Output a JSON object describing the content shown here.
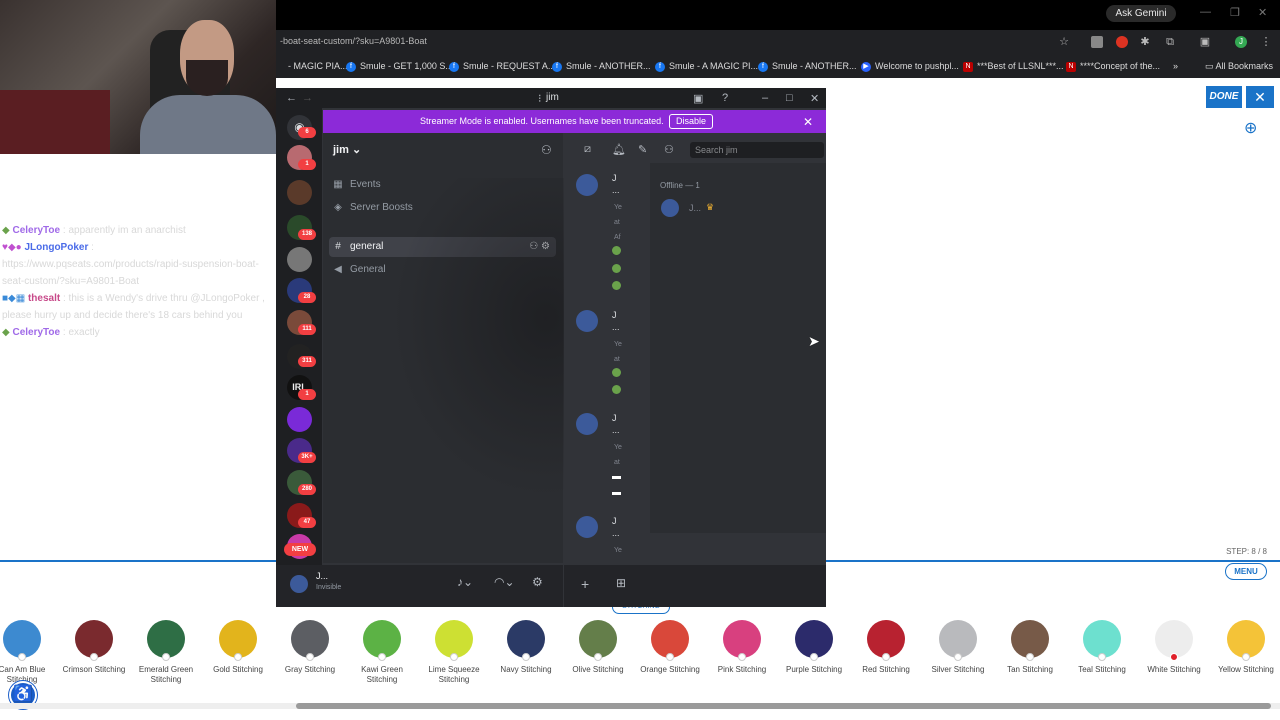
{
  "browser": {
    "ask_gemini": "Ask Gemini",
    "url": "-boat-seat-custom/?sku=A9801-Boat",
    "bookmarks": [
      {
        "label": "- MAGIC PIA..."
      },
      {
        "label": "Smule - GET 1,000 S..."
      },
      {
        "label": "Smule - REQUEST A..."
      },
      {
        "label": "Smule - ANOTHER..."
      },
      {
        "label": "Smule - A MAGIC PI..."
      },
      {
        "label": "Smule - ANOTHER..."
      },
      {
        "label": "Welcome to pushpl..."
      },
      {
        "label": "***Best of LLSNL***..."
      },
      {
        "label": "****Concept of the..."
      }
    ],
    "all_bookmarks": "All Bookmarks"
  },
  "chat": [
    {
      "badges": "◆",
      "name": "CeleryToe",
      "name_color": "#a06ae8",
      "text": ": apparently im an anarchist"
    },
    {
      "badges": "♥◆●",
      "name": "JLongoPoker",
      "name_color": "#4a6be8",
      "text": ":"
    },
    {
      "badges": "",
      "name": "",
      "name_color": "#d8d8d8",
      "text": "https://www.pqseats.com/products/rapid-suspension-boat-seat-custom/?sku=A9801-Boat"
    },
    {
      "badges": "■◆▦",
      "name": "thesalt",
      "name_color": "#c84a8a",
      "text": ": this is a Wendy's drive thru @JLongoPoker , please hurry up and decide there's 18 cars behind you"
    },
    {
      "badges": "◆",
      "name": "CeleryToe",
      "name_color": "#a06ae8",
      "text": ": exactly"
    }
  ],
  "discord": {
    "window_title": "jim",
    "streamer_banner": "Streamer Mode is enabled. Usernames have been truncated.",
    "disable": "Disable",
    "server_name": "jim",
    "channels": [
      {
        "icon": "▦",
        "label": "Events"
      },
      {
        "icon": "◈",
        "label": "Server Boosts"
      },
      {
        "icon": "#",
        "label": "general"
      },
      {
        "icon": "◀",
        "label": "General"
      }
    ],
    "search_placeholder": "Search jim",
    "guild_badges": [
      "6",
      "1",
      "138",
      "28",
      "111",
      "311",
      "1",
      "3K+",
      "280",
      "47"
    ],
    "new_badge": "NEW",
    "offline_header": "Offline — 1",
    "member_name": "J...",
    "user_name": "J...",
    "user_status": "Invisible",
    "messages": [
      {
        "author": "J",
        "dots": "...",
        "lines": [
          "Ye",
          "at",
          "Af"
        ]
      },
      {
        "author": "J",
        "dots": "...",
        "lines": [
          "Ye",
          "at"
        ]
      },
      {
        "author": "J",
        "dots": "...",
        "lines": [
          "Ye",
          "at"
        ]
      },
      {
        "author": "J",
        "dots": "...",
        "lines": [
          "Ye"
        ]
      }
    ]
  },
  "configurator": {
    "done": "DONE",
    "step": "STEP: 8 / 8",
    "menu": "MENU",
    "section_tag": "STITCHING",
    "swatches": [
      {
        "label": "Can Am Blue Stitching",
        "color": "#3d8ad0"
      },
      {
        "label": "Crimson Stitching",
        "color": "#7a2a2e"
      },
      {
        "label": "Emerald Green Stitching",
        "color": "#2e6e45"
      },
      {
        "label": "Gold Stitching",
        "color": "#e2b41c"
      },
      {
        "label": "Gray Stitching",
        "color": "#5c5e63"
      },
      {
        "label": "Kawi Green Stitching",
        "color": "#5cb245"
      },
      {
        "label": "Lime Squeeze Stitching",
        "color": "#cde033"
      },
      {
        "label": "Navy Stitching",
        "color": "#2b3a66"
      },
      {
        "label": "Olive Stitching",
        "color": "#647e4a"
      },
      {
        "label": "Orange Stitching",
        "color": "#d9483a"
      },
      {
        "label": "Pink Stitching",
        "color": "#d8407f"
      },
      {
        "label": "Purple Stitching",
        "color": "#2c2b6b"
      },
      {
        "label": "Red Stitching",
        "color": "#b82230"
      },
      {
        "label": "Silver Stitching",
        "color": "#b9babd"
      },
      {
        "label": "Tan Stitching",
        "color": "#775a48"
      },
      {
        "label": "Teal Stitching",
        "color": "#6de0cf"
      },
      {
        "label": "White Stitching",
        "color": "#ededed"
      },
      {
        "label": "Yellow Stitching",
        "color": "#f4c338"
      }
    ],
    "selected_swatch": "White Stitching"
  }
}
